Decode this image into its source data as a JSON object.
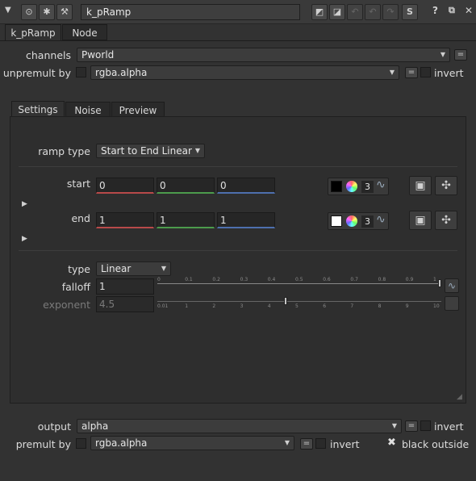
{
  "titlebar": {
    "node_name": "k_pRamp",
    "help_label": "?"
  },
  "tabs": [
    "k_pRamp",
    "Node"
  ],
  "channels": {
    "label": "channels",
    "value": "Pworld"
  },
  "unpremult_by": {
    "label": "unpremult by",
    "value": "rgba.alpha",
    "invert_label": "invert"
  },
  "subtabs": [
    "Settings",
    "Noise",
    "Preview"
  ],
  "ramp_type": {
    "label": "ramp type",
    "value": "Start to End Linear"
  },
  "start": {
    "label": "start",
    "values": [
      "0",
      "0",
      "0"
    ],
    "color_hex": "#000000",
    "channels_count": "3"
  },
  "end": {
    "label": "end",
    "values": [
      "1",
      "1",
      "1"
    ],
    "color_hex": "#ffffff",
    "channels_count": "3"
  },
  "type": {
    "label": "type",
    "value": "Linear"
  },
  "falloff": {
    "label": "falloff",
    "value": "1",
    "ticks": [
      "0",
      "0.1",
      "0.2",
      "0.3",
      "0.4",
      "0.5",
      "0.6",
      "0.7",
      "0.8",
      "0.9",
      "1"
    ],
    "slider_level": 1.0
  },
  "exponent": {
    "label": "exponent",
    "value": "4.5",
    "ticks": [
      "0.01",
      "1",
      "2",
      "3",
      "4",
      "5",
      "6",
      "7",
      "8",
      "9",
      "10"
    ],
    "slider_level": 0.45
  },
  "output": {
    "label": "output",
    "value": "alpha",
    "invert_label": "invert"
  },
  "premult_by": {
    "label": "premult by",
    "value": "rgba.alpha",
    "invert_label": "invert"
  },
  "black_outside": {
    "label": "black outside",
    "checked": true
  }
}
